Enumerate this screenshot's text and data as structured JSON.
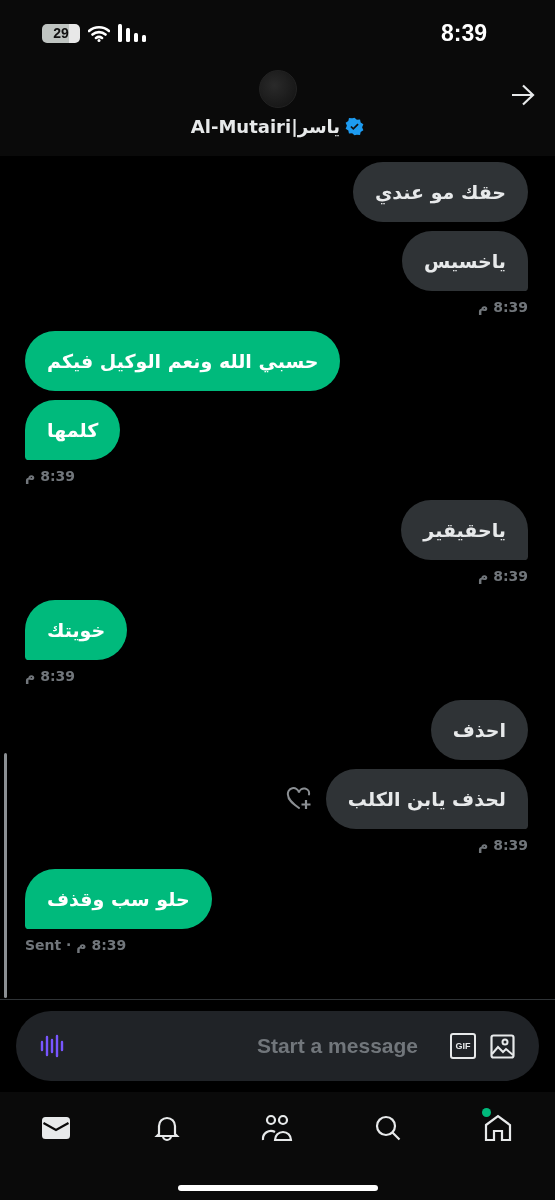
{
  "status_bar": {
    "time": "8:39",
    "battery": "29"
  },
  "header": {
    "name": "ياسر|Al-Mutairi",
    "verified": true
  },
  "messages": [
    {
      "outgoing": false,
      "text": "حقك مو عندي"
    },
    {
      "outgoing": false,
      "text": "ياخسيس",
      "time": "8:39 م"
    },
    {
      "outgoing": true,
      "text": "حسبي الله ونعم الوكيل فيكم"
    },
    {
      "outgoing": true,
      "text": "كلمها",
      "time": "8:39 م"
    },
    {
      "outgoing": false,
      "text": "ياحقيقير",
      "time": "8:39 م"
    },
    {
      "outgoing": true,
      "text": "خويتك",
      "time": "8:39 م"
    },
    {
      "outgoing": false,
      "text": "احذف"
    },
    {
      "outgoing": false,
      "text": "لحذف يابن الكلب",
      "time": "8:39 م",
      "react_icon": true
    },
    {
      "outgoing": true,
      "text": "حلو سب وقذف",
      "receipt": "Sent · م 8:39"
    }
  ],
  "composer": {
    "placeholder": "Start a message",
    "gif_label": "GIF"
  },
  "tabs": [
    {
      "kind": "mail",
      "selected": true,
      "dot": false
    },
    {
      "kind": "bell",
      "selected": false,
      "dot": false
    },
    {
      "kind": "people",
      "selected": false,
      "dot": false
    },
    {
      "kind": "search",
      "selected": false,
      "dot": false
    },
    {
      "kind": "home",
      "selected": false,
      "dot": true
    }
  ]
}
